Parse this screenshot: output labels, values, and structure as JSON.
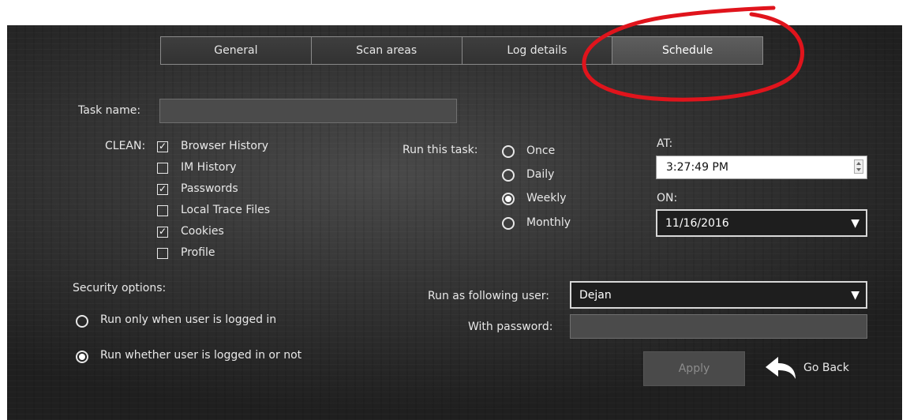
{
  "tabs": [
    {
      "label": "General",
      "active": false
    },
    {
      "label": "Scan areas",
      "active": false
    },
    {
      "label": "Log details",
      "active": false
    },
    {
      "label": "Schedule",
      "active": true
    }
  ],
  "task_name": {
    "label": "Task name:",
    "value": ""
  },
  "clean": {
    "label": "CLEAN:",
    "items": [
      {
        "label": "Browser History",
        "checked": true
      },
      {
        "label": "IM History",
        "checked": false
      },
      {
        "label": "Passwords",
        "checked": true
      },
      {
        "label": "Local Trace Files",
        "checked": false
      },
      {
        "label": "Cookies",
        "checked": true
      },
      {
        "label": "Profile",
        "checked": false
      }
    ]
  },
  "run_task": {
    "label": "Run this task:",
    "options": [
      {
        "label": "Once",
        "selected": false
      },
      {
        "label": "Daily",
        "selected": false
      },
      {
        "label": "Weekly",
        "selected": true
      },
      {
        "label": "Monthly",
        "selected": false
      }
    ]
  },
  "at": {
    "label": "AT:",
    "value": "3:27:49 PM"
  },
  "on": {
    "label": "ON:",
    "value": "11/16/2016"
  },
  "security": {
    "label": "Security options:",
    "options": [
      {
        "label": "Run only when user is logged in",
        "selected": false
      },
      {
        "label": "Run whether user is logged in or not",
        "selected": true
      }
    ]
  },
  "run_as": {
    "label": "Run as following user:",
    "value": "Dejan"
  },
  "password": {
    "label": "With password:",
    "value": ""
  },
  "buttons": {
    "apply": "Apply",
    "go_back": "Go Back"
  },
  "colors": {
    "highlight_circle": "#e0141c",
    "active_tab": "#555555",
    "panel": "#333333"
  }
}
